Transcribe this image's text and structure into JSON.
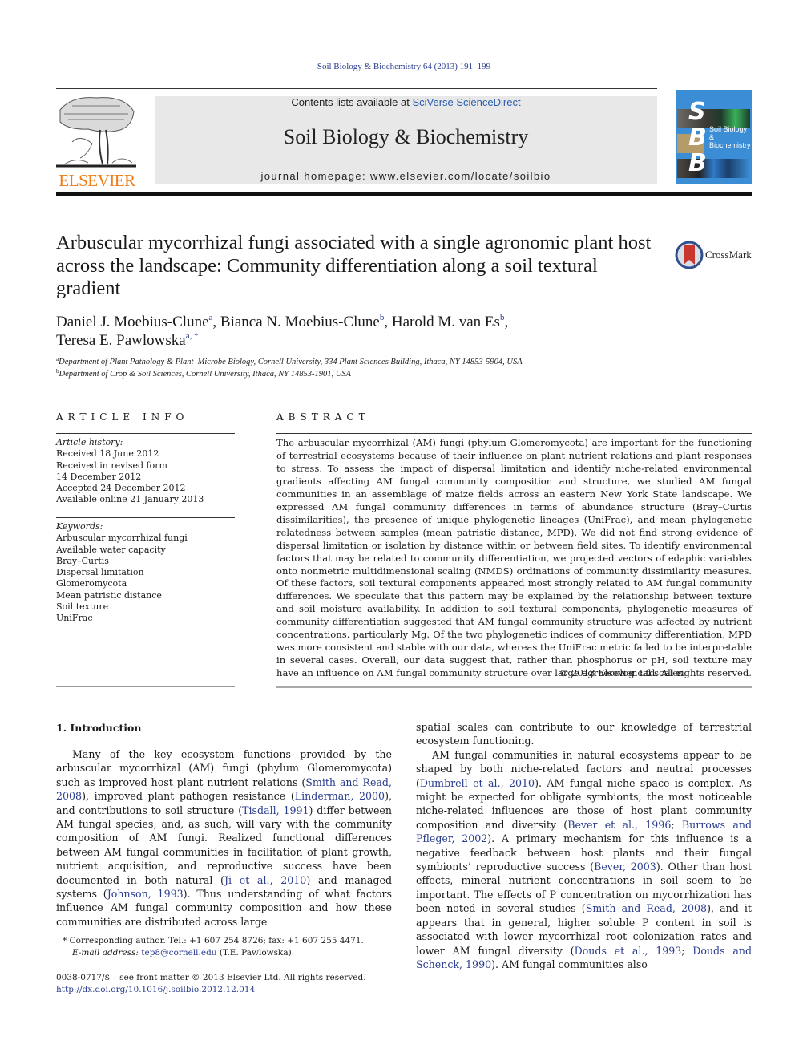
{
  "citation": "Soil Biology & Biochemistry 64 (2013) 191–199",
  "masthead": {
    "contents_prefix": "Contents lists available at ",
    "contents_link": "SciVerse ScienceDirect",
    "journal_title": "Soil Biology & Biochemistry",
    "homepage": "journal homepage: www.elsevier.com/locate/soilbio"
  },
  "publisher_logo": {
    "name": "ELSEVIER",
    "color": "#f07d16"
  },
  "cover": {
    "letters": [
      "S",
      "B",
      "B"
    ],
    "title_line1": "Soil Biology &",
    "title_line2": "Biochemistry",
    "color": "#3b8ed6"
  },
  "crossmark": {
    "label": "CrossMark"
  },
  "article": {
    "title": "Arbuscular mycorrhizal fungi associated with a single agronomic plant host across the landscape: Community differentiation along a soil textural gradient",
    "authors": [
      {
        "name": "Daniel J. Moebius-Clune",
        "sup": "a",
        "sep": ", "
      },
      {
        "name": "Bianca N. Moebius-Clune",
        "sup": "b",
        "sep": ", "
      },
      {
        "name": "Harold M. van Es",
        "sup": "b",
        "sep": ","
      },
      {
        "name": "Teresa E. Pawlowska",
        "sup": "a, *",
        "sep": ""
      }
    ],
    "affiliations": [
      {
        "sup": "a",
        "text": "Department of Plant Pathology & Plant–Microbe Biology, Cornell University, 334 Plant Sciences Building, Ithaca, NY 14853-5904, USA"
      },
      {
        "sup": "b",
        "text": "Department of Crop & Soil Sciences, Cornell University, Ithaca, NY 14853-1901, USA"
      }
    ]
  },
  "article_info": {
    "heading": "ARTICLE INFO",
    "history_label": "Article history:",
    "history": [
      "Received 18 June 2012",
      "Received in revised form",
      "14 December 2012",
      "Accepted 24 December 2012",
      "Available online 21 January 2013"
    ],
    "keywords_label": "Keywords:",
    "keywords": [
      "Arbuscular mycorrhizal fungi",
      "Available water capacity",
      "Bray–Curtis",
      "Dispersal limitation",
      "Glomeromycota",
      "Mean patristic distance",
      "Soil texture",
      "UniFrac"
    ]
  },
  "abstract": {
    "heading": "ABSTRACT",
    "text": "The arbuscular mycorrhizal (AM) fungi (phylum Glomeromycota) are important for the functioning of terrestrial ecosystems because of their influence on plant nutrient relations and plant responses to stress. To assess the impact of dispersal limitation and identify niche-related environmental gradients affecting AM fungal community composition and structure, we studied AM fungal communities in an assemblage of maize fields across an eastern New York State landscape. We expressed AM fungal community differences in terms of abundance structure (Bray–Curtis dissimilarities), the presence of unique phylogenetic lineages (UniFrac), and mean phylogenetic relatedness between samples (mean patristic distance, MPD). We did not find strong evidence of dispersal limitation or isolation by distance within or between field sites. To identify environmental factors that may be related to community differentiation, we projected vectors of edaphic variables onto nonmetric multidimensional scaling (NMDS) ordinations of community dissimilarity measures. Of these factors, soil textural components appeared most strongly related to AM fungal community differences. We speculate that this pattern may be explained by the relationship between texture and soil moisture availability. In addition to soil textural components, phylogenetic measures of community differentiation suggested that AM fungal community structure was affected by nutrient concentrations, particularly Mg. Of the two phylogenetic indices of community differentiation, MPD was more consistent and stable with our data, whereas the UniFrac metric failed to be interpretable in several cases. Overall, our data suggest that, rather than phosphorus or pH, soil texture may have an influence on AM fungal community structure over large agroecological scales.",
    "copyright": "© 2013 Elsevier Ltd. All rights reserved."
  },
  "introduction": {
    "heading": "1.  Introduction",
    "left_column": [
      {
        "t": "Many of the key ecosystem functions provided by the arbuscular mycorrhizal (AM) fungi (phylum Glomeromycota) such as improved host plant nutrient relations ("
      },
      {
        "link": "Smith and Read, 2008"
      },
      {
        "t": "), improved plant pathogen resistance ("
      },
      {
        "link": "Linderman, 2000"
      },
      {
        "t": "), and contributions to soil structure ("
      },
      {
        "link": "Tisdall, 1991"
      },
      {
        "t": ") differ between AM fungal species, and, as such, will vary with the community composition of AM fungi. Realized functional differences between AM fungal communities in facilitation of plant growth, nutrient acquisition, and reproductive success have been documented in both natural ("
      },
      {
        "link": "Ji et al., 2010"
      },
      {
        "t": ") and managed systems ("
      },
      {
        "link": "Johnson, 1993"
      },
      {
        "t": "). Thus understanding of what factors influence AM fungal community composition and how these communities are distributed across large"
      }
    ],
    "right_column_p1": "spatial scales can contribute to our knowledge of terrestrial ecosystem functioning.",
    "right_column_p2": [
      {
        "t": "AM fungal communities in natural ecosystems appear to be shaped by both niche-related factors and neutral processes ("
      },
      {
        "link": "Dumbrell et al., 2010"
      },
      {
        "t": "). AM fungal niche space is complex. As might be expected for obligate symbionts, the most noticeable niche-related influences are those of host plant community composition and diversity ("
      },
      {
        "link": "Bever et al., 1996"
      },
      {
        "t": "; "
      },
      {
        "link": "Burrows and Pfleger, 2002"
      },
      {
        "t": "). A primary mechanism for this influence is a negative feedback between host plants and their fungal symbionts’ reproductive success ("
      },
      {
        "link": "Bever, 2003"
      },
      {
        "t": "). Other than host effects, mineral nutrient concentrations in soil seem to be important. The effects of P concentration on mycorrhization has been noted in several studies ("
      },
      {
        "link": "Smith and Read, 2008"
      },
      {
        "t": "), and it appears that in general, higher soluble P content in soil is associated with lower mycorrhizal root colonization rates and lower AM fungal diversity ("
      },
      {
        "link": "Douds et al., 1993"
      },
      {
        "t": "; "
      },
      {
        "link": "Douds and Schenck, 1990"
      },
      {
        "t": "). AM fungal communities also"
      }
    ]
  },
  "footnotes": {
    "corresponding": "* Corresponding author. Tel.: +1 607 254 8726; fax: +1 607 255 4471.",
    "email_label": "E-mail address:",
    "email": "tep8@cornell.edu",
    "email_suffix": " (T.E. Pawlowska).",
    "front_matter": "0038-0717/$ – see front matter © 2013 Elsevier Ltd. All rights reserved.",
    "doi": "http://dx.doi.org/10.1016/j.soilbio.2012.12.014"
  },
  "colors": {
    "link": "#2a3d8f",
    "elsevier_orange": "#f07d16",
    "masthead_bg": "#e8e8e8"
  }
}
